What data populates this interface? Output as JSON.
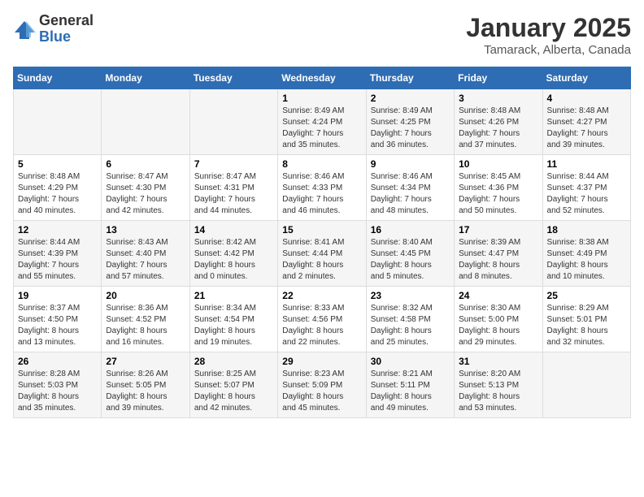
{
  "header": {
    "logo_general": "General",
    "logo_blue": "Blue",
    "month_title": "January 2025",
    "location": "Tamarack, Alberta, Canada"
  },
  "weekdays": [
    "Sunday",
    "Monday",
    "Tuesday",
    "Wednesday",
    "Thursday",
    "Friday",
    "Saturday"
  ],
  "weeks": [
    [
      {
        "day": "",
        "content": ""
      },
      {
        "day": "",
        "content": ""
      },
      {
        "day": "",
        "content": ""
      },
      {
        "day": "1",
        "content": "Sunrise: 8:49 AM\nSunset: 4:24 PM\nDaylight: 7 hours\nand 35 minutes."
      },
      {
        "day": "2",
        "content": "Sunrise: 8:49 AM\nSunset: 4:25 PM\nDaylight: 7 hours\nand 36 minutes."
      },
      {
        "day": "3",
        "content": "Sunrise: 8:48 AM\nSunset: 4:26 PM\nDaylight: 7 hours\nand 37 minutes."
      },
      {
        "day": "4",
        "content": "Sunrise: 8:48 AM\nSunset: 4:27 PM\nDaylight: 7 hours\nand 39 minutes."
      }
    ],
    [
      {
        "day": "5",
        "content": "Sunrise: 8:48 AM\nSunset: 4:29 PM\nDaylight: 7 hours\nand 40 minutes."
      },
      {
        "day": "6",
        "content": "Sunrise: 8:47 AM\nSunset: 4:30 PM\nDaylight: 7 hours\nand 42 minutes."
      },
      {
        "day": "7",
        "content": "Sunrise: 8:47 AM\nSunset: 4:31 PM\nDaylight: 7 hours\nand 44 minutes."
      },
      {
        "day": "8",
        "content": "Sunrise: 8:46 AM\nSunset: 4:33 PM\nDaylight: 7 hours\nand 46 minutes."
      },
      {
        "day": "9",
        "content": "Sunrise: 8:46 AM\nSunset: 4:34 PM\nDaylight: 7 hours\nand 48 minutes."
      },
      {
        "day": "10",
        "content": "Sunrise: 8:45 AM\nSunset: 4:36 PM\nDaylight: 7 hours\nand 50 minutes."
      },
      {
        "day": "11",
        "content": "Sunrise: 8:44 AM\nSunset: 4:37 PM\nDaylight: 7 hours\nand 52 minutes."
      }
    ],
    [
      {
        "day": "12",
        "content": "Sunrise: 8:44 AM\nSunset: 4:39 PM\nDaylight: 7 hours\nand 55 minutes."
      },
      {
        "day": "13",
        "content": "Sunrise: 8:43 AM\nSunset: 4:40 PM\nDaylight: 7 hours\nand 57 minutes."
      },
      {
        "day": "14",
        "content": "Sunrise: 8:42 AM\nSunset: 4:42 PM\nDaylight: 8 hours\nand 0 minutes."
      },
      {
        "day": "15",
        "content": "Sunrise: 8:41 AM\nSunset: 4:44 PM\nDaylight: 8 hours\nand 2 minutes."
      },
      {
        "day": "16",
        "content": "Sunrise: 8:40 AM\nSunset: 4:45 PM\nDaylight: 8 hours\nand 5 minutes."
      },
      {
        "day": "17",
        "content": "Sunrise: 8:39 AM\nSunset: 4:47 PM\nDaylight: 8 hours\nand 8 minutes."
      },
      {
        "day": "18",
        "content": "Sunrise: 8:38 AM\nSunset: 4:49 PM\nDaylight: 8 hours\nand 10 minutes."
      }
    ],
    [
      {
        "day": "19",
        "content": "Sunrise: 8:37 AM\nSunset: 4:50 PM\nDaylight: 8 hours\nand 13 minutes."
      },
      {
        "day": "20",
        "content": "Sunrise: 8:36 AM\nSunset: 4:52 PM\nDaylight: 8 hours\nand 16 minutes."
      },
      {
        "day": "21",
        "content": "Sunrise: 8:34 AM\nSunset: 4:54 PM\nDaylight: 8 hours\nand 19 minutes."
      },
      {
        "day": "22",
        "content": "Sunrise: 8:33 AM\nSunset: 4:56 PM\nDaylight: 8 hours\nand 22 minutes."
      },
      {
        "day": "23",
        "content": "Sunrise: 8:32 AM\nSunset: 4:58 PM\nDaylight: 8 hours\nand 25 minutes."
      },
      {
        "day": "24",
        "content": "Sunrise: 8:30 AM\nSunset: 5:00 PM\nDaylight: 8 hours\nand 29 minutes."
      },
      {
        "day": "25",
        "content": "Sunrise: 8:29 AM\nSunset: 5:01 PM\nDaylight: 8 hours\nand 32 minutes."
      }
    ],
    [
      {
        "day": "26",
        "content": "Sunrise: 8:28 AM\nSunset: 5:03 PM\nDaylight: 8 hours\nand 35 minutes."
      },
      {
        "day": "27",
        "content": "Sunrise: 8:26 AM\nSunset: 5:05 PM\nDaylight: 8 hours\nand 39 minutes."
      },
      {
        "day": "28",
        "content": "Sunrise: 8:25 AM\nSunset: 5:07 PM\nDaylight: 8 hours\nand 42 minutes."
      },
      {
        "day": "29",
        "content": "Sunrise: 8:23 AM\nSunset: 5:09 PM\nDaylight: 8 hours\nand 45 minutes."
      },
      {
        "day": "30",
        "content": "Sunrise: 8:21 AM\nSunset: 5:11 PM\nDaylight: 8 hours\nand 49 minutes."
      },
      {
        "day": "31",
        "content": "Sunrise: 8:20 AM\nSunset: 5:13 PM\nDaylight: 8 hours\nand 53 minutes."
      },
      {
        "day": "",
        "content": ""
      }
    ]
  ]
}
